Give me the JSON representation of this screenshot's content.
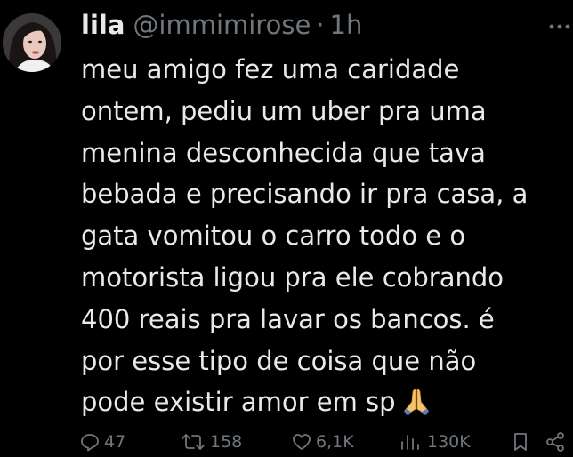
{
  "author": {
    "name": "lila",
    "handle": "@immimirose",
    "separator": "·",
    "time": "1h"
  },
  "tweet": {
    "lines": [
      "meu amigo fez uma caridade",
      "ontem, pediu um uber pra uma",
      "menina desconhecida que tava",
      "bebada e precisando ir pra casa, a",
      "gata vomitou o carro todo e o",
      "motorista ligou pra ele cobrando",
      "400 reais pra lavar os bancos. é",
      "por esse tipo de coisa que não",
      "pode existir amor em sp"
    ],
    "emoji": "praying-hands-emoji"
  },
  "actions": {
    "replies": "47",
    "retweets": "158",
    "likes": "6,1K",
    "views": "130K"
  },
  "icons": {
    "reply": "reply-icon",
    "retweet": "retweet-icon",
    "like": "heart-icon",
    "views": "views-chart-icon",
    "bookmark": "bookmark-icon",
    "share": "share-icon",
    "more": "more-dots-icon"
  },
  "colors": {
    "background": "#000000",
    "text": "#e7e9ea",
    "secondary": "#71767b"
  }
}
